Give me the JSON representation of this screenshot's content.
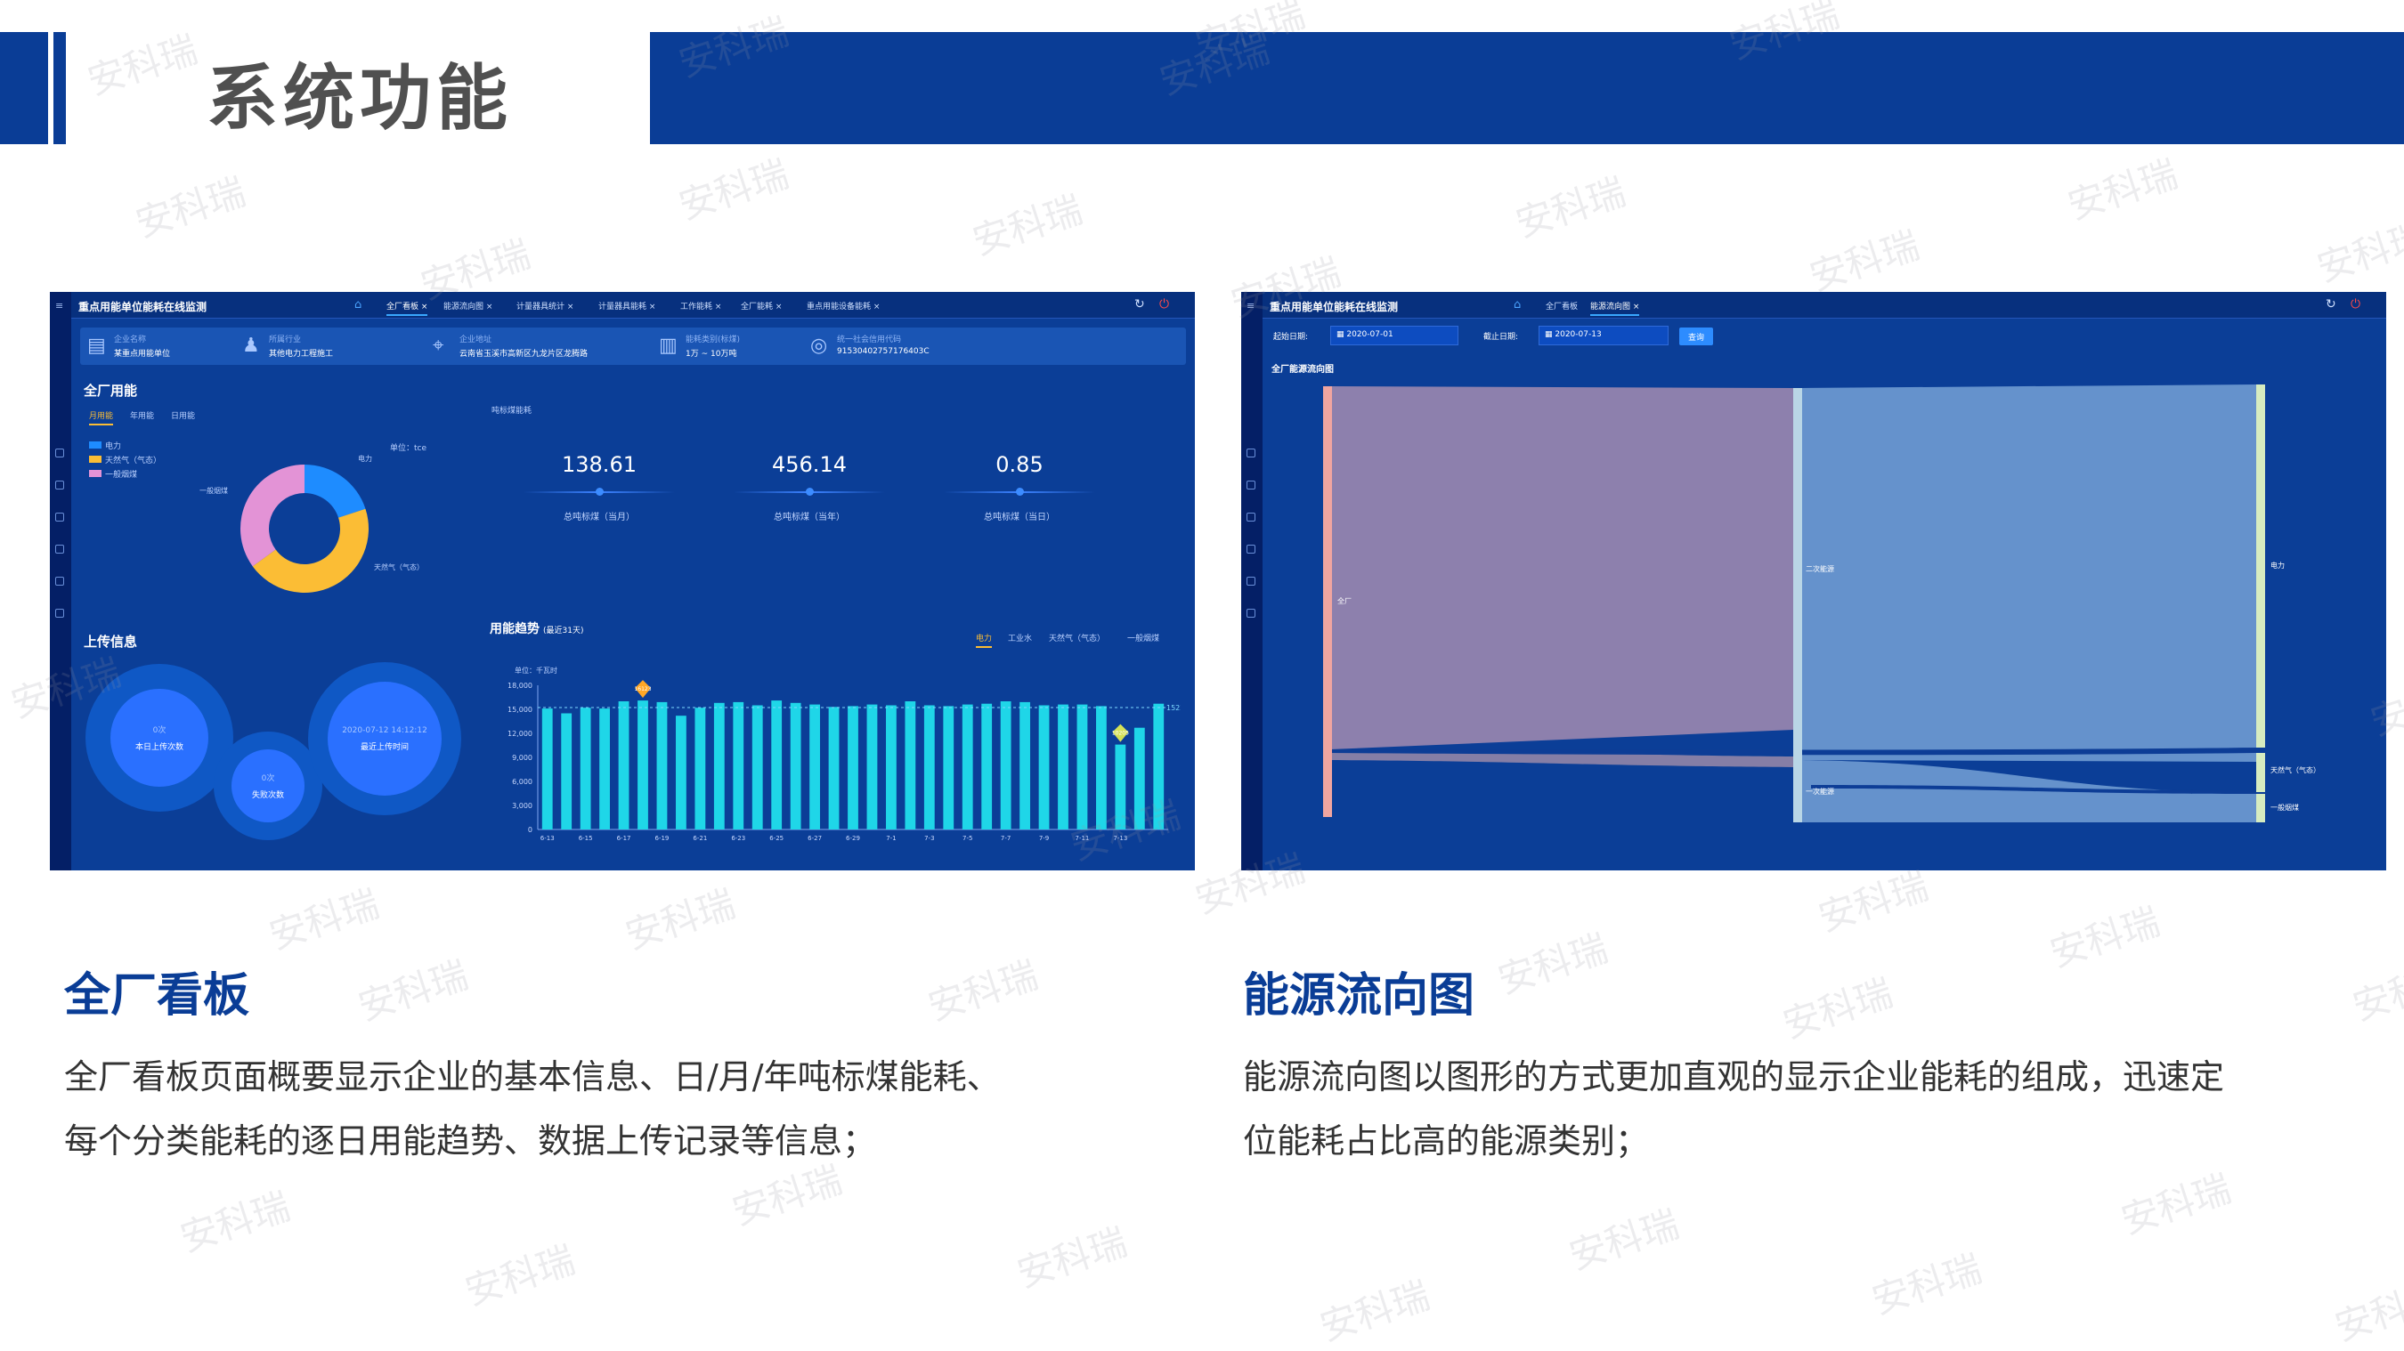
{
  "page": {
    "title": "系统功能",
    "watermark": "安科瑞"
  },
  "sections": [
    {
      "heading": "全厂看板",
      "desc_line1": "全厂看板页面概要显示企业的基本信息、日/月/年吨标煤能耗、",
      "desc_line2": "每个分类能耗的逐日用能趋势、数据上传记录等信息；"
    },
    {
      "heading": "能源流向图",
      "desc_line1": "能源流向图以图形的方式更加直观的显示企业能耗的组成，迅速定",
      "desc_line2": "位能耗占比高的能源类别；"
    }
  ],
  "dashboard": {
    "app_title": "重点用能单位能耗在线监测",
    "tabs": [
      "全厂看板 ×",
      "能源流向图 ×",
      "计量器具统计 ×",
      "计量器具能耗 ×",
      "工作能耗 ×",
      "全厂能耗 ×",
      "重点用能设备能耗 ×"
    ],
    "info": [
      {
        "label": "企业名称",
        "value": "某重点用能单位"
      },
      {
        "label": "所属行业",
        "value": "其他电力工程施工"
      },
      {
        "label": "企业地址",
        "value": "云南省玉溪市高新区九龙片区龙腾路"
      },
      {
        "label": "能耗类别(标煤)",
        "value": "1万 ~ 10万吨"
      },
      {
        "label": "统一社会信用代码",
        "value": "91530402757176403C"
      }
    ],
    "energy_title": "全厂用能",
    "energy_tabs": [
      "月用能",
      "年用能",
      "日用能"
    ],
    "legend": [
      "电力",
      "天然气（气态）",
      "一般烟煤"
    ],
    "unit": "单位：tce",
    "donut_labels": [
      "电力",
      "天然气（气态）",
      "一般烟煤"
    ],
    "donut_colors": [
      "#1e8cff",
      "#fbbd35",
      "#e393d6"
    ],
    "donut_shares": [
      0.2,
      0.45,
      0.35
    ],
    "kpi_title": "吨标煤能耗",
    "kpis": [
      {
        "value": "138.61",
        "label": "总吨标煤（当月）"
      },
      {
        "value": "456.14",
        "label": "总吨标煤（当年）"
      },
      {
        "value": "0.85",
        "label": "总吨标煤（当日）"
      }
    ],
    "upload_title": "上传信息",
    "uploads": [
      {
        "value": "0次",
        "label": "本日上传次数"
      },
      {
        "value": "0次",
        "label": "失败次数"
      },
      {
        "value": "2020-07-12 14:12:12",
        "label": "最近上传时间"
      }
    ],
    "trend_title": "用能趋势",
    "trend_sub": "(最近31天)",
    "trend_tabs": [
      "电力",
      "工业水",
      "天然气（气态）",
      "一般烟煤"
    ],
    "trend_unit": "单位：千瓦时",
    "trend_avg_label": "15227.65",
    "trend_max_label": "16123",
    "trend_min_label": "10205"
  },
  "chart_data": {
    "type": "bar",
    "title": "用能趋势",
    "ylabel": "单位：千瓦时",
    "ylim": [
      0,
      18000
    ],
    "yticks": [
      "18,000",
      "15,000",
      "12,000",
      "9,000",
      "6,000",
      "3,000",
      "0"
    ],
    "xticks": [
      "6-13",
      "6-15",
      "6-17",
      "6-19",
      "6-21",
      "6-23",
      "6-25",
      "6-27",
      "6-29",
      "7-1",
      "7-3",
      "7-5",
      "7-7",
      "7-9",
      "7-11",
      "7-13"
    ],
    "values": [
      15100,
      14500,
      15200,
      15100,
      16000,
      16100,
      15900,
      14200,
      15200,
      15800,
      15900,
      15500,
      16100,
      15800,
      15600,
      15300,
      15400,
      15600,
      15500,
      16000,
      15500,
      15400,
      15600,
      15700,
      16000,
      15900,
      15500,
      15600,
      15600,
      15400,
      10600,
      12700,
      15700
    ],
    "average": 15227.65
  },
  "sankey": {
    "app_title": "重点用能单位能耗在线监测",
    "tabs": [
      "全厂看板",
      "能源流向图 ×"
    ],
    "start_label": "起始日期:",
    "start_value": "2020-07-01",
    "end_label": "截止日期:",
    "end_value": "2020-07-13",
    "query_btn": "查询",
    "section_title": "全厂能源流向图",
    "nodes": [
      "全厂",
      "二次能源",
      "一次能源",
      "电力",
      "天然气（气态）",
      "一般烟煤"
    ]
  }
}
